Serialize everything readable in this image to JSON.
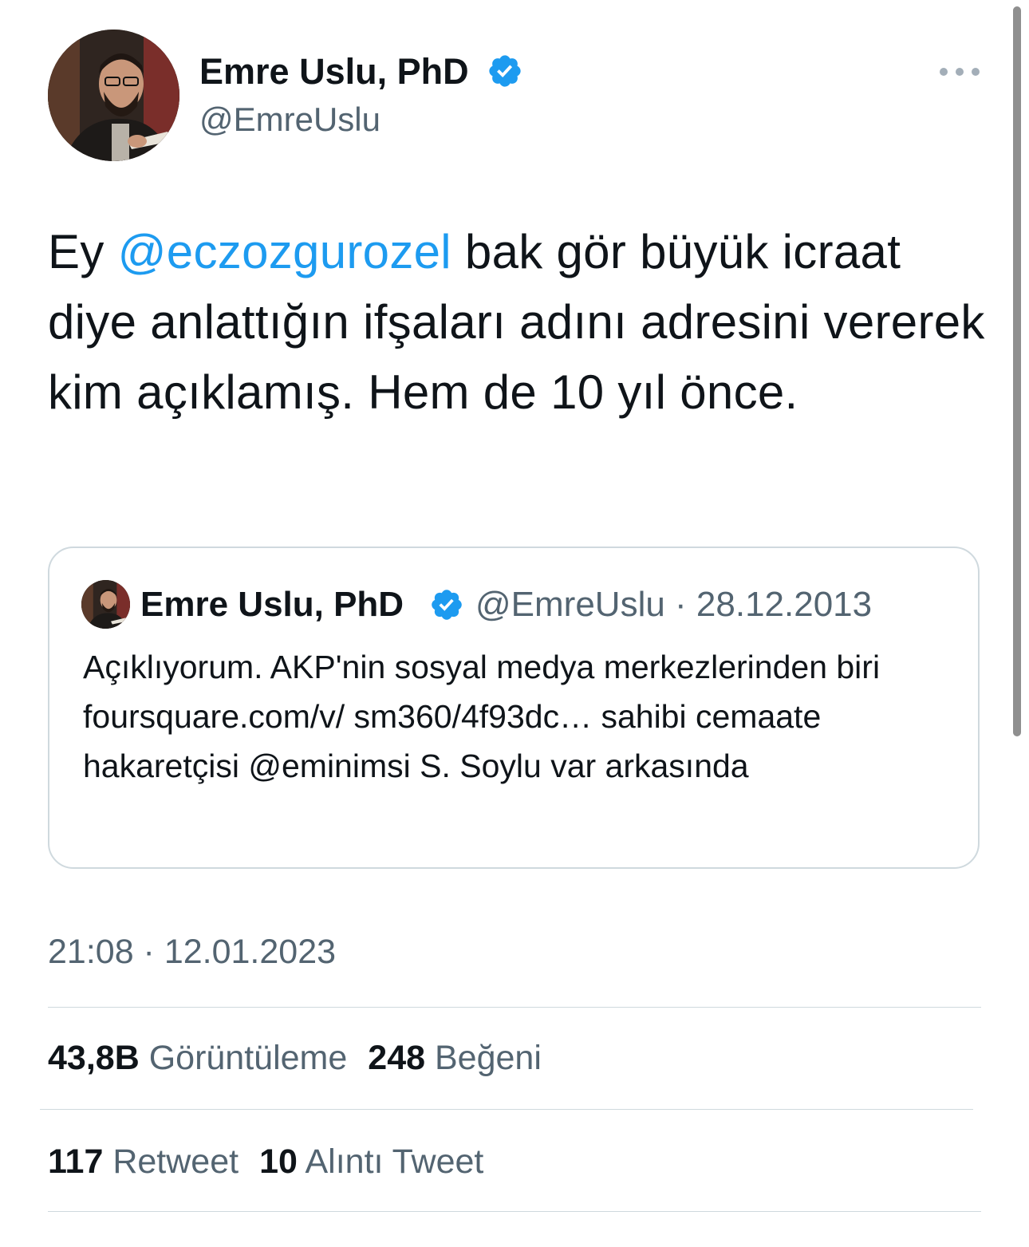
{
  "tweet": {
    "author": {
      "display_name": "Emre Uslu, PhD",
      "handle": "@EmreUslu",
      "verified": true
    },
    "text_parts": {
      "before": "Ey ",
      "mention": "@eczozgurozel",
      "after": " bak gör büyük icraat diye anlattığın ifşaları adını adresini vererek kim açıklamış. Hem de 10 yıl önce."
    },
    "quoted": {
      "display_name": "Emre Uslu, PhD",
      "meta": "@EmreUslu · 28.12.2013",
      "text": "Açıklıyorum. AKP'nin sosyal medya merkezlerinden biri foursquare.com/v/ sm360/4f93dc… sahibi cemaate hakaretçisi @eminimsi S. Soylu var arkasında"
    },
    "timestamp": "21:08 · 12.01.2023",
    "stats": {
      "views_count": "43,8B",
      "views_label": "Görüntüleme",
      "likes_count": "248",
      "likes_label": "Beğeni",
      "retweets_count": "117",
      "retweets_label": "Retweet",
      "quotes_count": "10",
      "quotes_label": "Alıntı Tweet"
    }
  },
  "colors": {
    "text": "#0f1419",
    "secondary": "#536471",
    "link": "#1d9bf0",
    "border": "#cfd9de"
  }
}
